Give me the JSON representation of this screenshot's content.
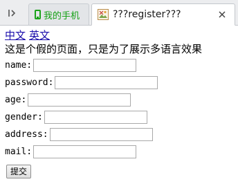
{
  "tabs": [
    {
      "label": "我的手机",
      "icon": "phone-icon",
      "color": "#14a114"
    },
    {
      "label": "???register???",
      "icon": "broken-image-icon",
      "active": true
    }
  ],
  "page": {
    "lang_links": [
      "中文",
      "英文"
    ],
    "note": "这是个假的页面，只是为了展示多语言效果",
    "fields": [
      {
        "label": "name:",
        "value": ""
      },
      {
        "label": "password:",
        "value": ""
      },
      {
        "label": "age:",
        "value": ""
      },
      {
        "label": "gender:",
        "value": ""
      },
      {
        "label": "address:",
        "value": ""
      },
      {
        "label": "mail:",
        "value": ""
      }
    ],
    "submit_label": "提交"
  },
  "colors": {
    "link": "#1a0dab",
    "accent_green": "#14a114"
  }
}
